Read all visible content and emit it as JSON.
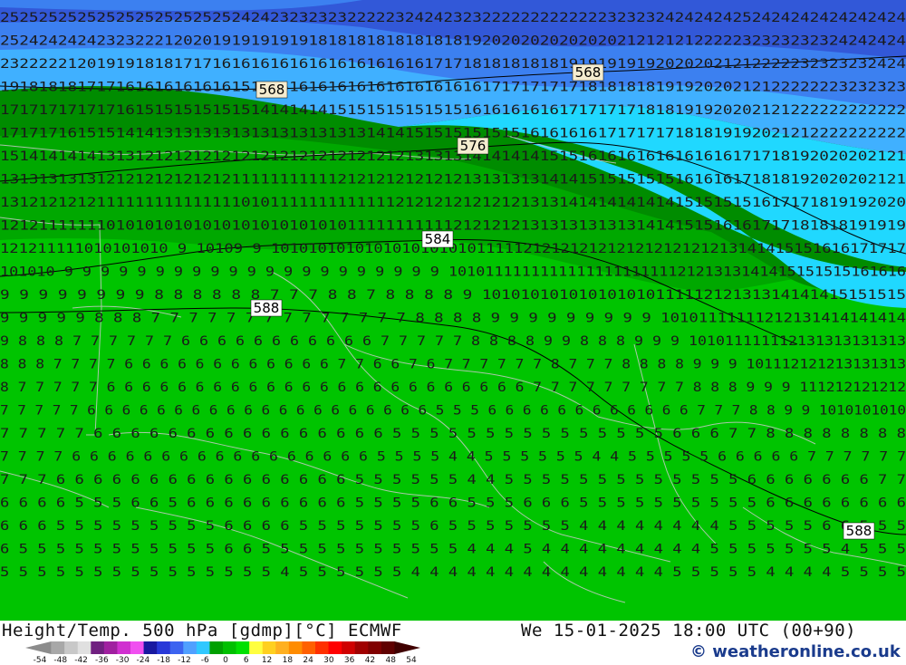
{
  "title": "Height/Temp. 500 hPa [gdmp][°C] ECMWF",
  "datetime": "We 15-01-2025 18:00 UTC (00+90)",
  "credit": "© weatheronline.co.uk",
  "contour_labels": [
    "568",
    "568",
    "576",
    "584",
    "588",
    "588"
  ],
  "scale_labels": [
    "-54",
    "-48",
    "-42",
    "-36",
    "-30",
    "-24",
    "-18",
    "-12",
    "-6",
    "0",
    "6",
    "12",
    "18",
    "24",
    "30",
    "36",
    "42",
    "48",
    "54"
  ],
  "scale_colors": [
    "#8c8c8c",
    "#a8a8a8",
    "#c8c8c8",
    "#e0e0e0",
    "#702080",
    "#a020a0",
    "#d030d0",
    "#f050f0",
    "#1818a0",
    "#2838d8",
    "#3c64f0",
    "#50a0ff",
    "#30c8ff",
    "#00a000",
    "#00c000",
    "#00e000",
    "#ffff40",
    "#ffd020",
    "#ffb020",
    "#ff8c00",
    "#ff6000",
    "#ff3000",
    "#ff0000",
    "#d00000",
    "#a00000",
    "#800000",
    "#600000",
    "#400000"
  ],
  "map_colors": {
    "blue_dark": "#3258d8",
    "blue_mid": "#3c80f0",
    "blue_light": "#40b0ff",
    "cyan": "#20d8ff",
    "green_dark": "#008c00",
    "green_mid": "#00a800",
    "green_light": "#00c400",
    "green_bright": "#00d800"
  },
  "temperature_rows": [
    "2525252525252525252525252424232323232222232424232322222222222223232324242424252424242424242424",
    "2524242424232322212020191919191918181818181818181920202020202020212121212222232323232324242424",
    "2322222120191918181717161616161616161616161617171818181818191919191920202021212222232323232424",
    "1918181817171616161616161515151616161616161616161617171717171818181819192020212122222223232323",
    "1717171717171615151515151514141414151515151515151616161616171717171818191920202121222222222222",
    "1717171615151414131313131313131313131314141515151515151616161617171717181819192021212222222222",
    "1514141414131312121212121212121212121212121313131414141415151616161616161616171718192020202121",
    "1313131313121212121212121111111111121212121212121313131314141515151515161616171818192020202121",
    "1312121212111111111111111010111111111111121212121212121313141414141414151515151617171819192020",
    "1212111111101010101010101010101010101111111111121212121313131313131414151516161717181818191919",
    "121211111010101010 9 10109 9 10101010101010101010101111121212121212121212121213141415151616171717",
    "101010 9 9 9 9 9 9 9 9 9 9 9 9 9 9 9 9 9 9 9 9 9 10101111111111111111111112121313141415151515161616",
    "9 9 9 9 9 9 9 9 8 8 8 8 8 8 7 7 7 8 8 7 8 8 8 8 9 10101010101010101011111212131314141415151515",
    "9 9 9 9 9 8 8 8 7 7 7 7 7 7 7 7 7 7 7 7 7 7 8 8 8 8 9 9 9 9 9 9 9 9 9 10101111111212131414141414",
    "9 8 8 8 7 7 7 7 7 7 6 6 6 6 6 6 6 6 6 6 6 7 7 7 7 7 8 8 8 8 9 9 8 8 8 9 9 9 101011111112131313131313",
    "8 8 8 7 7 7 7 6 6 6 6 6 6 6 6 6 6 6 6 7 7 6 6 7 6 7 7 7 7 7 7 8 7 7 7 8 8 8 8 9 9 9 101112121213131313",
    "8 7 7 7 7 7 6 6 6 6 6 6 6 6 6 6 6 6 6 6 6 6 6 6 6 6 6 6 6 6 7 7 7 7 7 7 7 7 7 8 8 8 9 9 9 111212121212",
    "7 7 7 7 7 6 6 6 6 6 6 6 6 6 6 6 6 6 6 6 6 6 6 6 6 5 5 5 6 6 6 6 6 6 6 6 6 6 6 6 7 7 7 8 8 9 9 1010101010",
    "7 7 7 7 7 6 6 6 6 6 6 6 6 6 6 6 6 6 6 6 6 5 5 5 5 5 5 5 5 5 5 5 5 5 5 5 6 6 6 7 7 8 8 8 8 8 8 8 8",
    "7 7 7 7 6 6 6 6 6 6 6 6 6 6 6 6 6 6 6 6 6 5 5 5 5 4 4 5 5 5 5 5 5 4 4 5 5 5 5 5 6 6 6 6 6 7 7 7 7 7 7",
    "7 7 7 6 6 6 6 6 6 6 6 6 6 6 6 6 6 6 6 5 5 5 5 5 5 4 4 5 5 5 5 5 5 5 5 5 5 5 5 5 6 6 6 6 6 6 6 7 7",
    "6 6 6 6 5 5 5 6 6 5 6 6 6 6 6 6 6 6 6 5 5 5 5 6 6 5 5 5 6 6 6 5 5 5 5 5 5 5 5 5 5 6 6 6 6 6 6 6 6",
    "6 6 6 5 5 5 5 5 5 5 5 5 6 6 6 6 5 5 5 5 5 5 5 6 5 5 5 5 5 5 5 4 4 4 4 4 4 4 4 5 5 5 5 5 6 6 5 5 5",
    "6 5 5 5 5 5 5 5 5 5 5 5 6 6 5 5 5 5 5 5 5 5 5 5 5 4 4 4 5 4 4 4 4 4 4 4 4 4 5 5 5 5 5 5 5 4 5 5 5",
    "5 5 5 5 5 5 5 5 5 5 5 5 5 5 5 4 5 5 5 5 5 5 4 4 4 4 4 4 4 4 4 4 4 4 4 4 5 5 5 5 5 4 4 4 4 5 5 5 5"
  ]
}
